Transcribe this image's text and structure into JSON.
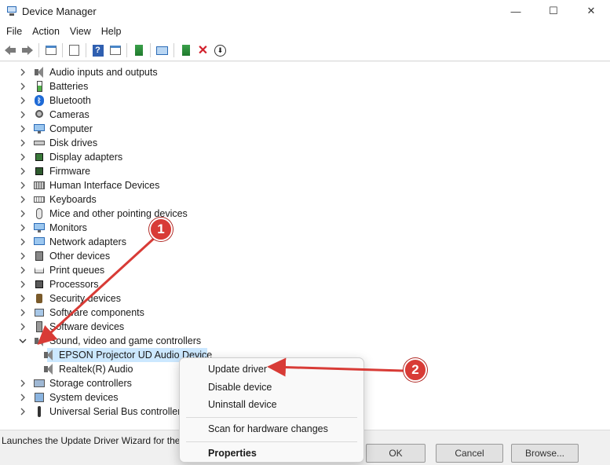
{
  "window": {
    "title": "Device Manager",
    "minimize": "—",
    "maximize": "☐",
    "close": "✕"
  },
  "menu": [
    "File",
    "Action",
    "View",
    "Help"
  ],
  "tree": [
    {
      "label": "Audio inputs and outputs",
      "icon": "speaker-icon"
    },
    {
      "label": "Batteries",
      "icon": "battery-icon"
    },
    {
      "label": "Bluetooth",
      "icon": "bluetooth-icon"
    },
    {
      "label": "Cameras",
      "icon": "camera-icon"
    },
    {
      "label": "Computer",
      "icon": "computer-icon"
    },
    {
      "label": "Disk drives",
      "icon": "disk-icon"
    },
    {
      "label": "Display adapters",
      "icon": "display-adapter-icon"
    },
    {
      "label": "Firmware",
      "icon": "chip-icon"
    },
    {
      "label": "Human Interface Devices",
      "icon": "hid-icon"
    },
    {
      "label": "Keyboards",
      "icon": "keyboard-icon"
    },
    {
      "label": "Mice and other pointing devices",
      "icon": "mouse-icon"
    },
    {
      "label": "Monitors",
      "icon": "monitor-icon"
    },
    {
      "label": "Network adapters",
      "icon": "network-icon"
    },
    {
      "label": "Other devices",
      "icon": "other-device-icon"
    },
    {
      "label": "Print queues",
      "icon": "printer-icon"
    },
    {
      "label": "Processors",
      "icon": "processor-icon"
    },
    {
      "label": "Security devices",
      "icon": "security-key-icon"
    },
    {
      "label": "Software components",
      "icon": "software-component-icon"
    },
    {
      "label": "Software devices",
      "icon": "software-device-icon"
    },
    {
      "label": "Sound, video and game controllers",
      "icon": "speaker-icon",
      "expanded": true
    },
    {
      "label": "EPSON Projector UD Audio Device",
      "icon": "speaker-icon",
      "child": true,
      "selected": true
    },
    {
      "label": "Realtek(R) Audio",
      "icon": "speaker-icon",
      "child": true
    },
    {
      "label": "Storage controllers",
      "icon": "storage-icon"
    },
    {
      "label": "System devices",
      "icon": "system-icon"
    },
    {
      "label": "Universal Serial Bus controllers",
      "icon": "usb-icon"
    }
  ],
  "context_menu": {
    "update": "Update driver",
    "disable": "Disable device",
    "uninstall": "Uninstall device",
    "scan": "Scan for hardware changes",
    "properties": "Properties"
  },
  "status": {
    "text": "Launches the Update Driver Wizard for the s",
    "ok": "OK",
    "cancel": "Cancel",
    "browse": "Browse..."
  },
  "callouts": {
    "one": "1",
    "two": "2"
  },
  "colors": {
    "selection": "#cce8ff",
    "callout": "#d83b36",
    "remove": "#d2202b"
  }
}
